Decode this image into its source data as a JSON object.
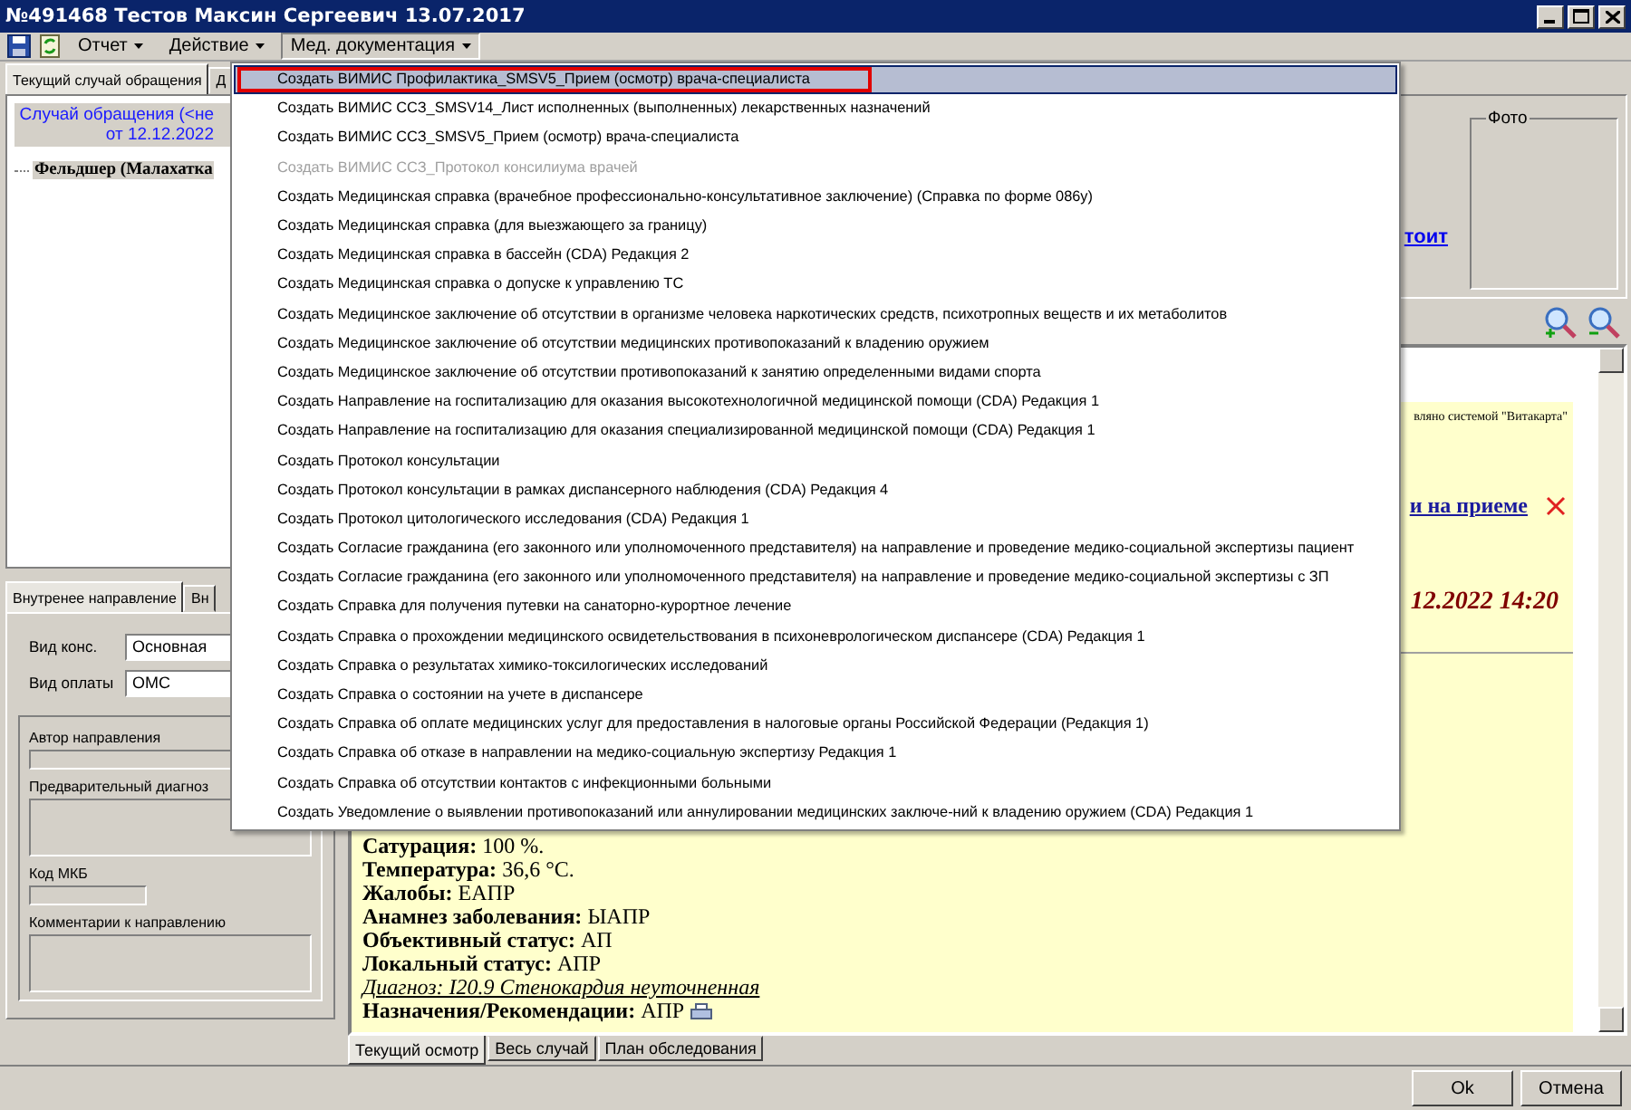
{
  "window": {
    "title": "№491468 Тестов Максин Сергеевич 13.07.2017"
  },
  "toolbar": {
    "items": [
      {
        "label": "Отчет",
        "open": false
      },
      {
        "label": "Действие",
        "open": false
      },
      {
        "label": "Мед. документация",
        "open": true
      }
    ]
  },
  "menu": {
    "items": [
      {
        "label": "Создать ВИМИС Профилактика_SMSV5_Прием (осмотр) врача-специалиста",
        "selected": true,
        "disabled": false,
        "marked": true
      },
      {
        "label": "Создать ВИМИС ССЗ_SMSV14_Лист исполненных (выполненных) лекарственных назначений",
        "selected": false,
        "disabled": false,
        "marked": false
      },
      {
        "label": "Создать ВИМИС ССЗ_SMSV5_Прием (осмотр) врача-специалиста",
        "selected": false,
        "disabled": false,
        "marked": false
      },
      {
        "label": "Создать ВИМИС ССЗ_Протокол консилиума врачей",
        "selected": false,
        "disabled": true,
        "marked": false
      },
      {
        "label": "Создать Медицинская справка (врачебное профессионально-консультативное заключение) (Справка по форме 086у)",
        "selected": false,
        "disabled": false,
        "marked": false
      },
      {
        "label": "Создать Медицинская справка (для выезжающего за границу)",
        "selected": false,
        "disabled": false,
        "marked": false
      },
      {
        "label": "Создать Медицинская справка в бассейн (CDA) Редакция 2",
        "selected": false,
        "disabled": false,
        "marked": false
      },
      {
        "label": "Создать Медицинская справка о допуске к управлению ТС",
        "selected": false,
        "disabled": false,
        "marked": false
      },
      {
        "label": "Создать Медицинское заключение об отсутствии в организме человека наркотических средств, психотропных веществ и их метаболитов",
        "selected": false,
        "disabled": false,
        "marked": false
      },
      {
        "label": "Создать Медицинское заключение об отсутствии медицинских противопоказаний к владению оружием",
        "selected": false,
        "disabled": false,
        "marked": false
      },
      {
        "label": "Создать Медицинское заключение об отсутствии противопоказаний к занятию определенными видами спорта",
        "selected": false,
        "disabled": false,
        "marked": false
      },
      {
        "label": "Создать Направление на госпитализацию для оказания высокотехнологичной медицинской помощи (CDA) Редакция 1",
        "selected": false,
        "disabled": false,
        "marked": false
      },
      {
        "label": "Создать Направление на госпитализацию для оказания специализированной медицинской помощи (CDA) Редакция 1",
        "selected": false,
        "disabled": false,
        "marked": false
      },
      {
        "label": "Создать Протокол консультации",
        "selected": false,
        "disabled": false,
        "marked": false
      },
      {
        "label": "Создать Протокол консультации в рамках диспансерного наблюдения (CDA) Редакция 4",
        "selected": false,
        "disabled": false,
        "marked": false
      },
      {
        "label": "Создать Протокол цитологического исследования (CDA) Редакция 1",
        "selected": false,
        "disabled": false,
        "marked": false
      },
      {
        "label": "Создать Согласие гражданина (его законного или уполномоченного представителя) на направление и проведение медико-социальной экспертизы пациент",
        "selected": false,
        "disabled": false,
        "marked": false
      },
      {
        "label": "Создать Согласие гражданина (его законного или уполномоченного представителя) на направление и проведение медико-социальной экспертизы с ЗП",
        "selected": false,
        "disabled": false,
        "marked": false
      },
      {
        "label": "Создать Справка для получения путевки на санаторно-курортное лечение",
        "selected": false,
        "disabled": false,
        "marked": false
      },
      {
        "label": "Создать Справка о прохождении медицинского освидетельствования в психоневрологическом диспансере (CDA) Редакция 1",
        "selected": false,
        "disabled": false,
        "marked": false
      },
      {
        "label": "Создать Справка о результатах химико-токсилогических исследований",
        "selected": false,
        "disabled": false,
        "marked": false
      },
      {
        "label": "Создать Справка о состоянии на учете в диспансере",
        "selected": false,
        "disabled": false,
        "marked": false
      },
      {
        "label": "Создать Справка об оплате медицинских услуг для предоставления в налоговые органы Российской Федерации (Редакция 1)",
        "selected": false,
        "disabled": false,
        "marked": false
      },
      {
        "label": "Создать Справка об отказе в направлении на медико-социальную экспертизу Редакция 1",
        "selected": false,
        "disabled": false,
        "marked": false
      },
      {
        "label": "Создать Справка об отсутствии контактов с инфекционными больными",
        "selected": false,
        "disabled": false,
        "marked": false
      },
      {
        "label": "Создать Уведомление о выявлении противопоказаний или аннулировании медицинских заключе-ний к владению оружием (CDA) Редакция 1",
        "selected": false,
        "disabled": false,
        "marked": false
      }
    ]
  },
  "case_panel": {
    "tabs": [
      {
        "label": "Текущий случай обращения",
        "selected": true
      },
      {
        "label": "Д",
        "selected": false
      }
    ],
    "header": [
      "Случай обращения (<не",
      "от 12.12.2022"
    ],
    "tree": [
      {
        "label": "Фельдшер (Малахатка",
        "selected": true
      }
    ]
  },
  "referral": {
    "tabs": [
      {
        "label": "Внутренее направление",
        "selected": true
      },
      {
        "label": "Вн",
        "selected": false
      }
    ],
    "fields": [
      {
        "label": "Вид конс.",
        "value": "Основная"
      },
      {
        "label": "Вид оплаты",
        "value": "ОМС"
      }
    ],
    "group": [
      {
        "label": "Автор направления",
        "kind": "line"
      },
      {
        "label": "Предварительный диагноз",
        "kind": "area"
      },
      {
        "label": "Код МКБ",
        "kind": "short"
      },
      {
        "label": "Комментарии к направлению",
        "kind": "area"
      }
    ]
  },
  "patient_panel": {
    "link": "тоит",
    "photo_label": "Фото"
  },
  "document": {
    "note": "вляно системой \"Витакарта\"",
    "visit_link": "и на приеме",
    "date": "12.2022 14:20",
    "lines": [
      {
        "kind": "field",
        "label": "Сатурация:",
        "value": "100 %.",
        "printable": false
      },
      {
        "kind": "field",
        "label": "Температура:",
        "value": "36,6 °C.",
        "printable": false
      },
      {
        "kind": "field",
        "label": "Жалобы:",
        "value": "ЕАПР",
        "printable": false
      },
      {
        "kind": "field",
        "label": "Анамнез заболевания:",
        "value": "ЫАПР",
        "printable": false
      },
      {
        "kind": "field",
        "label": "Объективный статус:",
        "value": "АП",
        "printable": false
      },
      {
        "kind": "field",
        "label": "Локальный статус:",
        "value": "АПР",
        "printable": false
      },
      {
        "kind": "diagnosis",
        "label": "Диагноз: I20.9 Стенокардия неуточненная",
        "printable": false
      },
      {
        "kind": "field",
        "label": "Назначения/Рекомендации:",
        "value": "АПР",
        "printable": true
      }
    ]
  },
  "document_tabs": [
    {
      "label": "Текущий осмотр",
      "selected": true
    },
    {
      "label": "Весь случай",
      "selected": false
    },
    {
      "label": "План обследования",
      "selected": false
    }
  ],
  "buttons": [
    "Ok",
    "Отмена"
  ]
}
